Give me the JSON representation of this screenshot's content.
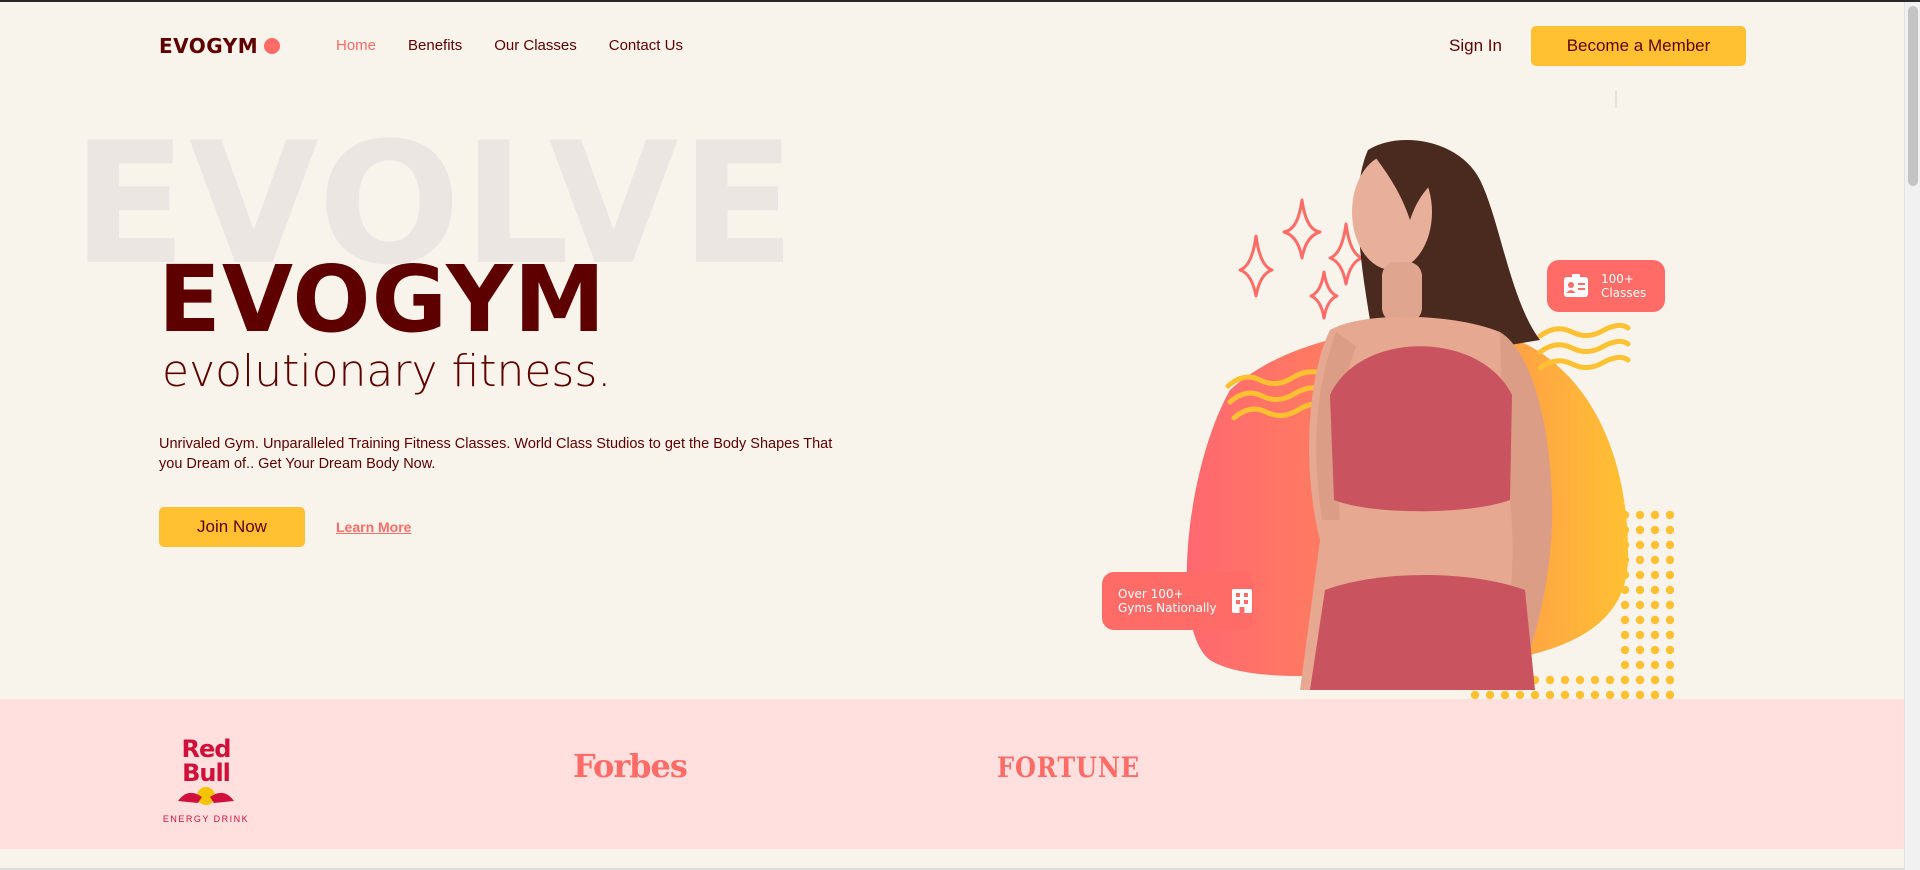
{
  "nav": {
    "logo_text": "EVOGYM",
    "links": [
      {
        "label": "Home",
        "active": true
      },
      {
        "label": "Benefits",
        "active": false
      },
      {
        "label": "Our Classes",
        "active": false
      },
      {
        "label": "Contact Us",
        "active": false
      }
    ],
    "sign_in": "Sign In",
    "member_button": "Become a Member"
  },
  "hero": {
    "background_word": "EVOLVE",
    "title": "EVOGYM",
    "tagline": "evolutionary fitness.",
    "description": "Unrivaled Gym. Unparalleled Training Fitness Classes. World Class Studios to get the Body Shapes That you Dream of.. Get Your Dream Body Now.",
    "join_button": "Join Now",
    "learn_more": "Learn More"
  },
  "badges": {
    "classes": {
      "line1": "100+",
      "line2": "Classes",
      "icon": "id-card-icon"
    },
    "gyms": {
      "line1": "Over 100+",
      "line2": "Gyms Nationally",
      "icon": "building-icon"
    }
  },
  "sponsors": {
    "redbull": {
      "name": "Red Bull",
      "sub": "ENERGY DRINK"
    },
    "forbes": "Forbes",
    "fortune": "FORTUNE"
  },
  "colors": {
    "background": "#f8f4ec",
    "primary_dark": "#5e0000",
    "accent_red": "#ff6b66",
    "accent_yellow": "#ffc132",
    "sponsor_band": "#ffe0df"
  }
}
